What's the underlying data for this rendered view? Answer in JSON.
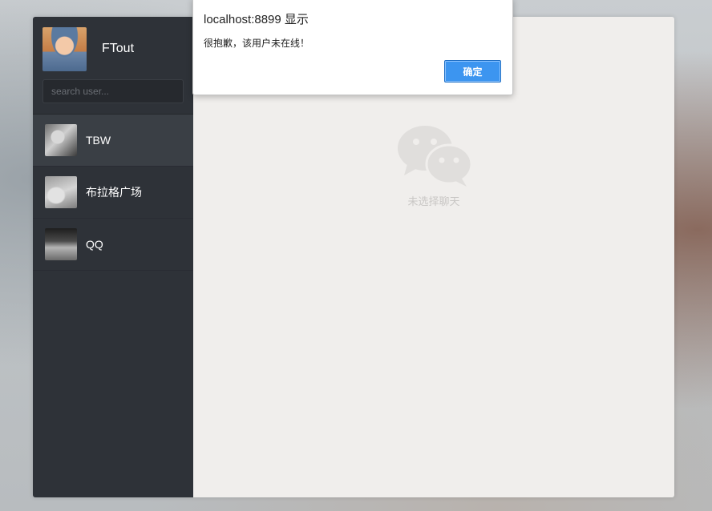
{
  "user": {
    "name": "FTout"
  },
  "search": {
    "placeholder": "search user..."
  },
  "contacts": [
    {
      "name": "TBW"
    },
    {
      "name": "布拉格广场"
    },
    {
      "name": "QQ"
    }
  ],
  "empty_state": {
    "text": "未选择聊天",
    "icon": "wechat-icon"
  },
  "dialog": {
    "title": "localhost:8899 显示",
    "message": "很抱歉，该用户未在线！",
    "ok_label": "确定"
  },
  "colors": {
    "sidebar_bg": "#2e3238",
    "main_bg": "#f0eeec",
    "button_blue": "#3c95f0"
  }
}
